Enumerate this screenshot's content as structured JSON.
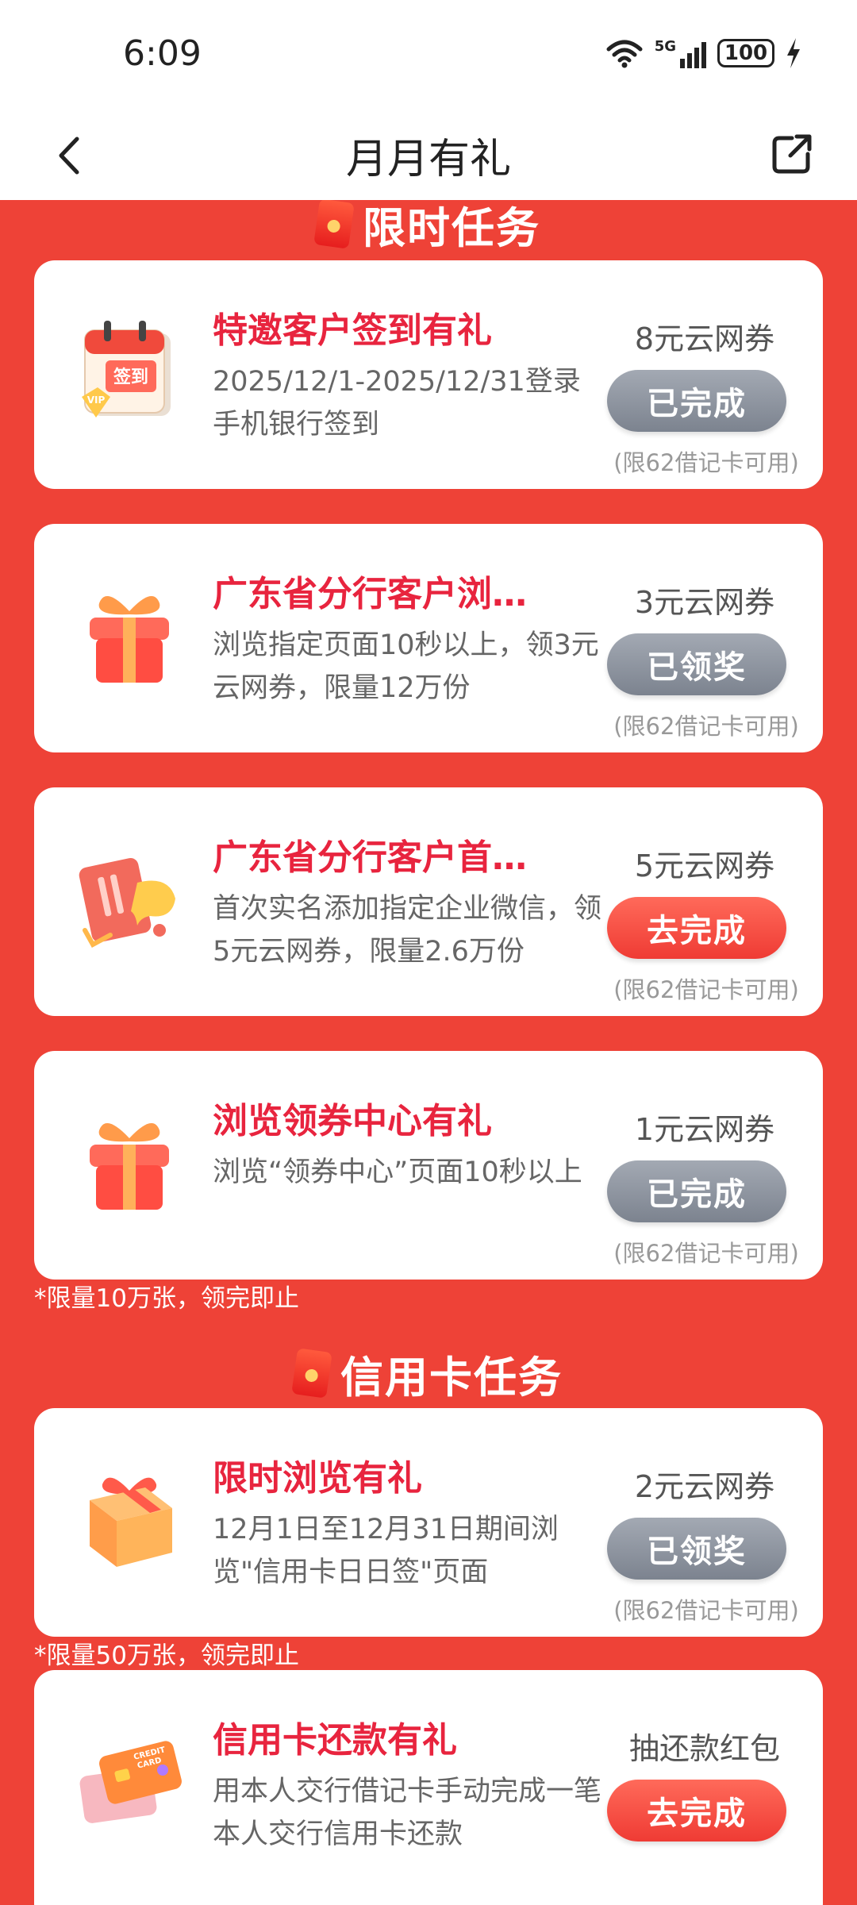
{
  "status_bar": {
    "time": "6:09",
    "network": "5G",
    "battery": "100"
  },
  "header": {
    "title": "月月有礼"
  },
  "sections": [
    {
      "title": "限时任务"
    },
    {
      "title": "信用卡任务"
    }
  ],
  "tasks": [
    {
      "title": "特邀客户签到有礼",
      "desc": "2025/12/1-2025/12/31登录手机银行签到",
      "reward": "8元云网券",
      "button": "已完成",
      "note": "(限62借记卡可用)"
    },
    {
      "title": "广东省分行客户浏…",
      "desc": "浏览指定页面10秒以上，领3元云网券，限量12万份",
      "reward": "3元云网券",
      "button": "已领奖",
      "note": "(限62借记卡可用)"
    },
    {
      "title": "广东省分行客户首…",
      "desc": "首次实名添加指定企业微信，领5元云网券，限量2.6万份",
      "reward": "5元云网券",
      "button": "去完成",
      "note": "(限62借记卡可用)"
    },
    {
      "title": "浏览领券中心有礼",
      "desc": "浏览“领券中心”页面10秒以上",
      "reward": "1元云网券",
      "button": "已完成",
      "note": "(限62借记卡可用)"
    },
    {
      "title": "限时浏览有礼",
      "desc": "12月1日至12月31日期间浏览\"信用卡日日签\"页面",
      "reward": "2元云网券",
      "button": "已领奖",
      "note": "(限62借记卡可用)"
    },
    {
      "title": "信用卡还款有礼",
      "desc": "用本人交行借记卡手动完成一笔本人交行信用卡还款",
      "reward": "抽还款红包",
      "button": "去完成"
    }
  ],
  "notes": {
    "limit_1": "*限量10万张，领完即止",
    "limit_2": "*限量50万张，领完即止"
  },
  "colors": {
    "brand_red": "#ee4237",
    "title_red": "#e8243e",
    "done_gray": "#8a909b"
  }
}
